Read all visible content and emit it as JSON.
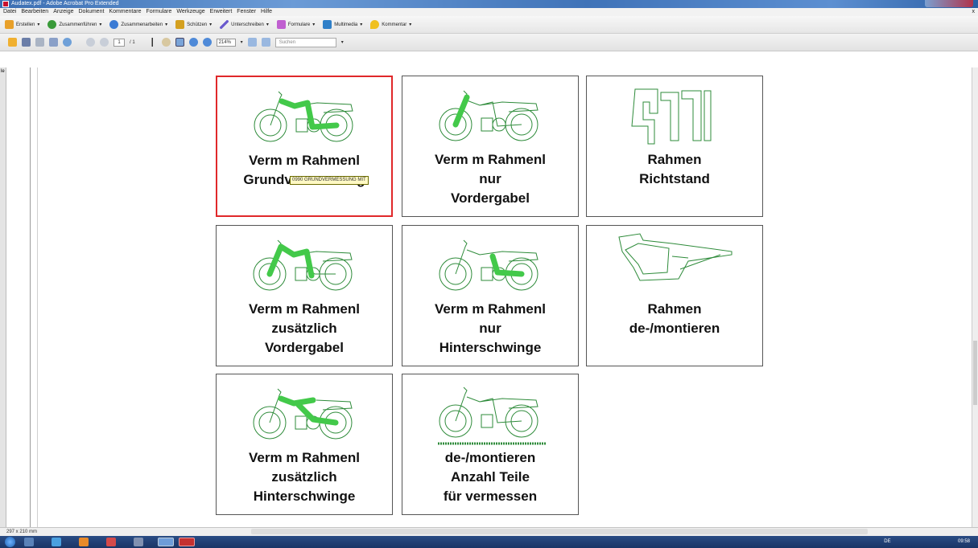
{
  "window": {
    "title": "Audatex.pdf - Adobe Acrobat Pro Extended"
  },
  "menu": {
    "items": [
      "Datei",
      "Bearbeiten",
      "Anzeige",
      "Dokument",
      "Kommentare",
      "Formulare",
      "Werkzeuge",
      "Erweitert",
      "Fenster",
      "Hilfe"
    ],
    "close": "x"
  },
  "toolbar": {
    "erstellen": "Erstellen",
    "zusammenfuehren": "Zusammenführen",
    "zusammenarbeiten": "Zusammenarbeiten",
    "schuetzen": "Schützen",
    "unterschreiben": "Unterschreiben",
    "formulare": "Formulare",
    "multimedia": "Multimedia",
    "kommentar": "Kommentar"
  },
  "nav": {
    "page_current": "1",
    "page_total": "/ 1",
    "zoom": "214%",
    "search_placeholder": "Suchen"
  },
  "leftpanel": {
    "tab": "le"
  },
  "tiles": [
    {
      "line1": "Verm m Rahmenl",
      "line2": "Grundvermessung",
      "line3": ""
    },
    {
      "line1": "Verm m Rahmenl",
      "line2": "nur",
      "line3": "Vordergabel"
    },
    {
      "line1": "Rahmen",
      "line2": "Richtstand",
      "line3": ""
    },
    {
      "line1": "Verm m Rahmenl",
      "line2": "zusätzlich",
      "line3": "Vordergabel"
    },
    {
      "line1": "Verm m Rahmenl",
      "line2": "nur",
      "line3": "Hinterschwinge"
    },
    {
      "line1": "Rahmen",
      "line2": "de-/montieren",
      "line3": ""
    },
    {
      "line1": "Verm m Rahmenl",
      "line2": "zusätzlich",
      "line3": "Hinterschwinge"
    },
    {
      "line1": "de-/montieren",
      "line2": "Anzahl Teile",
      "line3": "für vermessen"
    }
  ],
  "tooltip": "0990 GRUNDVERMESSUNG MIT",
  "status": {
    "page_size": "297 x 210 mm"
  },
  "tray": {
    "lang": "DE",
    "time": "09:58"
  },
  "colors": {
    "selected_border": "#e0282a",
    "bike_line": "#2e8b3a",
    "highlight": "#43c94a"
  }
}
